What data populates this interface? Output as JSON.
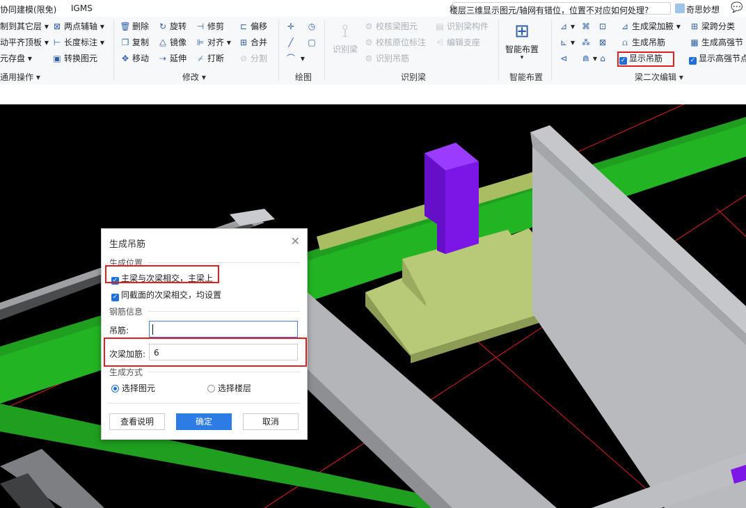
{
  "topbar": {
    "tab_left": "协同建模(限免)",
    "tab_igms": "IGMS",
    "search_text": "楼层三维显示图元/轴网有错位，位置不对应如何处理?",
    "user_name": "奇思妙想"
  },
  "ribbon": {
    "common": {
      "items": [
        "制到其它层",
        "动平齐顶板",
        "元存盘"
      ],
      "btn_two_point_axis": "两点辅轴",
      "btn_length_dim": "长度标注",
      "btn_convert": "转换图元",
      "label": "通用操作"
    },
    "modify": {
      "items": [
        "删除",
        "旋转",
        "修剪",
        "偏移",
        "复制",
        "镜像",
        "对齐",
        "合并",
        "移动",
        "延伸",
        "打断",
        "分割"
      ],
      "label": "修改"
    },
    "draw": {
      "label": "绘图"
    },
    "identify_beam": {
      "big": "识别梁",
      "items": [
        "校核梁图元",
        "识别梁构件",
        "校核原位标注",
        "编辑支座",
        "识别吊筋"
      ],
      "label": "识别梁"
    },
    "smart": {
      "big": "智能布置",
      "label": "智能布置"
    },
    "beam2": {
      "items": [
        "生成梁加腋",
        "梁跨分类",
        "生成吊筋",
        "生成高强节",
        "显示吊筋",
        "显示高强节点"
      ],
      "label": "梁二次编辑"
    }
  },
  "dialog": {
    "title": "生成吊筋",
    "section_position": "生成位置",
    "cb_main_secondary": "主梁与次梁相交，主梁上",
    "cb_same_section": "同截面的次梁相交，均设置",
    "section_rebar": "钢筋信息",
    "field_hanger_label": "吊筋:",
    "field_hanger_value": "",
    "field_secondary_label": "次梁加筋:",
    "field_secondary_value": "6",
    "section_method": "生成方式",
    "radio_select_element": "选择图元",
    "radio_select_floor": "选择楼层",
    "btn_help": "查看说明",
    "btn_ok": "确定",
    "btn_cancel": "取消"
  },
  "colors": {
    "beam_green": "#22b422",
    "accent_blue": "#2d7be5",
    "highlight_red": "#e02020",
    "column_purple": "#7b16e6",
    "footing_olive": "#aabd63"
  }
}
